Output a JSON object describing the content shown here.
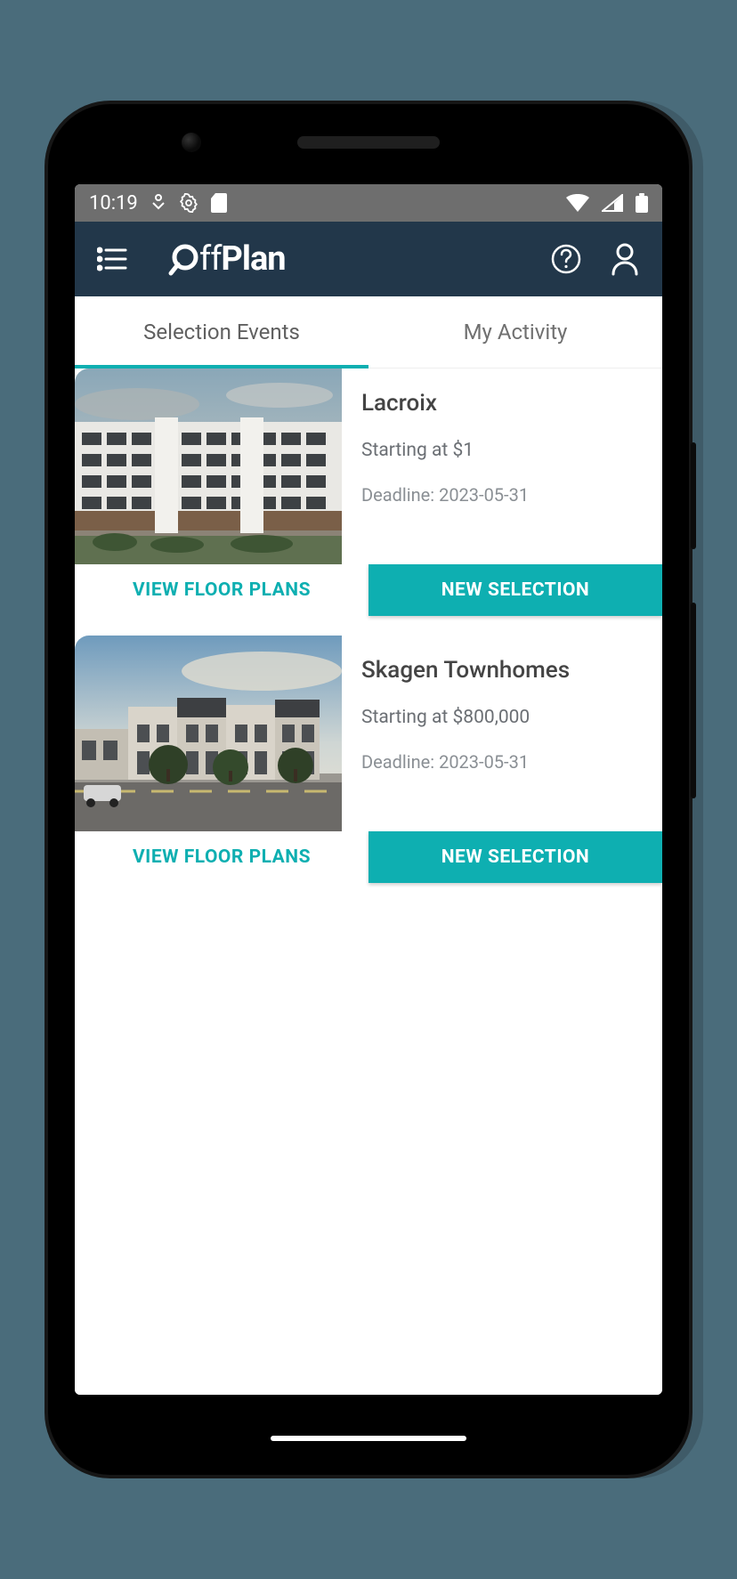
{
  "status": {
    "time": "10:19"
  },
  "app": {
    "logo_text": "OffPlan"
  },
  "tabs": {
    "events": "Selection Events",
    "activity": "My Activity",
    "active": "events"
  },
  "buttons": {
    "view_plans": "VIEW FLOOR PLANS",
    "new_selection": "NEW SELECTION"
  },
  "labels": {
    "starting": "Starting at",
    "deadline": "Deadline:"
  },
  "listings": [
    {
      "title": "Lacroix",
      "price": "$1",
      "deadline": "2023-05-31"
    },
    {
      "title": "Skagen Townhomes",
      "price": "$800,000",
      "deadline": "2023-05-31"
    }
  ]
}
